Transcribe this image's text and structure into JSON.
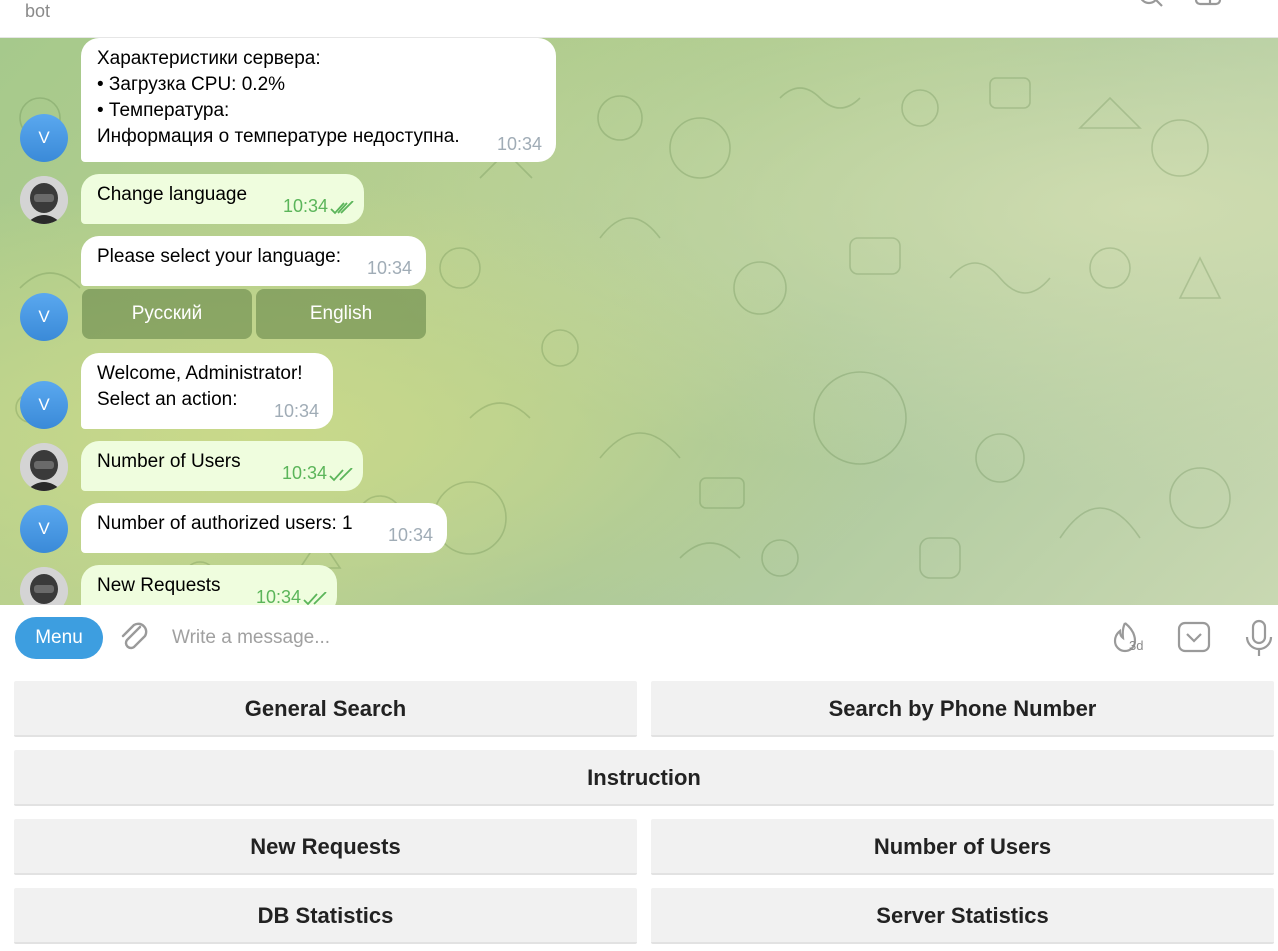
{
  "header": {
    "status": "bot",
    "icons": [
      "search-icon",
      "sidebar-icon",
      "more-vertical-icon"
    ]
  },
  "bot_avatar_letter": "V",
  "messages": [
    {
      "lines": [
        "Характеристики сервера:",
        "• Загрузка CPU: 0.2%",
        "• Температура:",
        "Информация о температуре недоступна."
      ],
      "time": "10:34"
    },
    {
      "text": "Change language",
      "time": "10:34"
    },
    {
      "text": "Please select your language:",
      "time": "10:34"
    },
    {
      "lines": [
        "Welcome, Administrator!",
        "Select an action:"
      ],
      "time": "10:34"
    },
    {
      "text": "Number of Users",
      "time": "10:34"
    },
    {
      "text": "Number of authorized users: 1",
      "time": "10:34"
    },
    {
      "text": "New Requests",
      "time": "10:34"
    }
  ],
  "inline_keyboard": [
    "Русский",
    "English"
  ],
  "composer": {
    "menu_label": "Menu",
    "placeholder": "Write a message...",
    "timer_label": "3d"
  },
  "reply_keyboard": [
    [
      "General Search",
      "Search by Phone Number"
    ],
    [
      "Instruction"
    ],
    [
      "New Requests",
      "Number of Users"
    ],
    [
      "DB Statistics",
      "Server Statistics"
    ]
  ],
  "colors": {
    "accent": "#3d9ee0",
    "outgoing_bubble": "#effdde",
    "read_checks": "#5bb55a"
  }
}
